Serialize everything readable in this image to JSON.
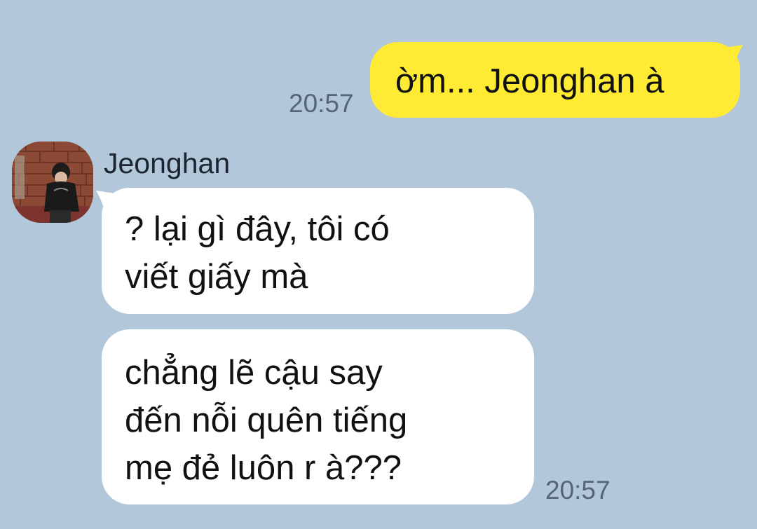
{
  "messages": {
    "outgoing": {
      "text": "ờm... Jeonghan à",
      "time": "20:57"
    },
    "incoming": {
      "sender": "Jeonghan",
      "avatar_icon": "profile-photo",
      "bubbles": [
        {
          "lines": [
            "? lại gì đây, tôi có",
            "viết giấy mà"
          ]
        },
        {
          "lines": [
            "chẳng lẽ cậu say",
            "đến nỗi quên tiếng",
            "mẹ đẻ luôn r à???"
          ]
        }
      ],
      "time": "20:57"
    }
  },
  "colors": {
    "background": "#b2c7da",
    "outgoing_bubble": "#ffeb33",
    "incoming_bubble": "#ffffff",
    "timestamp": "#556577"
  }
}
